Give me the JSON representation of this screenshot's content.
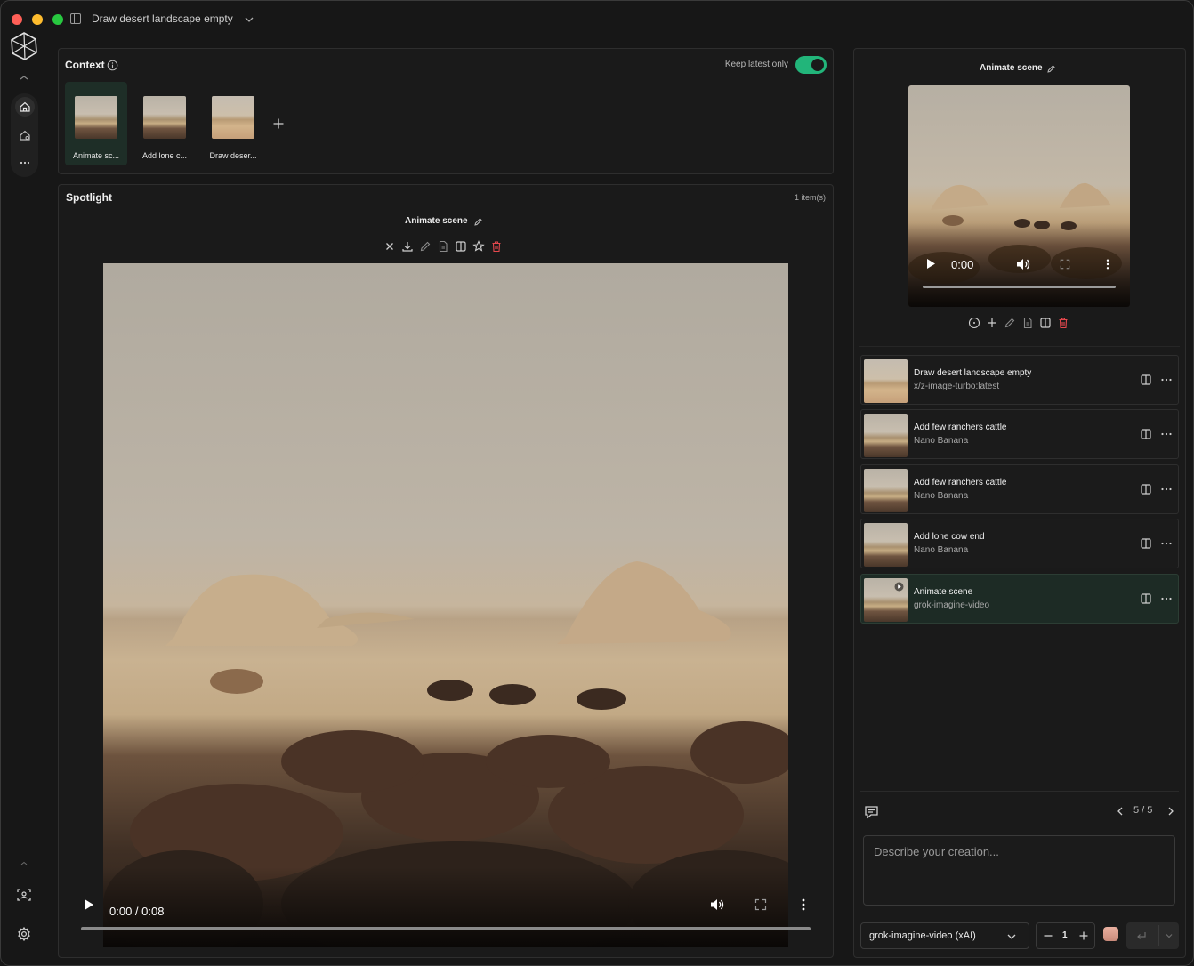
{
  "window": {
    "title": "Draw desert landscape empty"
  },
  "context": {
    "label": "Context",
    "keep_latest_label": "Keep latest only",
    "keep_latest_on": true,
    "items": [
      {
        "label": "Animate sc..."
      },
      {
        "label": "Add lone c..."
      },
      {
        "label": "Draw deser..."
      }
    ]
  },
  "spotlight": {
    "label": "Spotlight",
    "count": "1 item(s)",
    "item_name": "Animate scene",
    "video_time": "0:00 / 0:08"
  },
  "right_panel": {
    "preview_name": "Animate scene",
    "preview_time": "0:00"
  },
  "history": [
    {
      "title": "Draw desert landscape empty",
      "model": "x/z-image-turbo:latest"
    },
    {
      "title": "Add few ranchers cattle",
      "model": "Nano Banana"
    },
    {
      "title": "Add few ranchers cattle",
      "model": "Nano Banana"
    },
    {
      "title": "Add lone cow end",
      "model": "Nano Banana"
    },
    {
      "title": "Animate scene",
      "model": "grok-imagine-video"
    }
  ],
  "pager": "5 / 5",
  "prompt": {
    "placeholder": "Describe your creation..."
  },
  "model_select": {
    "value": "grok-imagine-video (xAI)"
  },
  "stepper": {
    "value": "1"
  },
  "colors": {
    "accent": "#22b57a",
    "danger": "#e5484d",
    "active_bg": "#1d2b25"
  }
}
